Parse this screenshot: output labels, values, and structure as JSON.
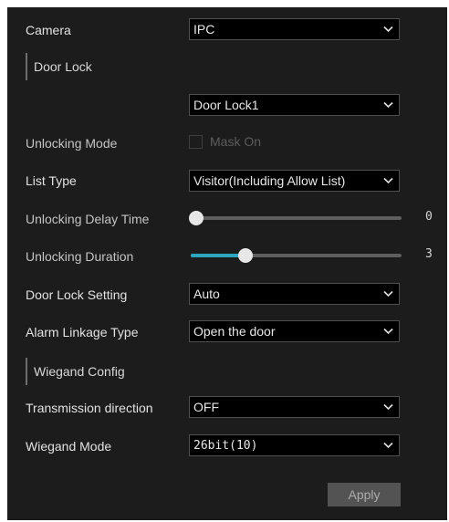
{
  "form": {
    "camera_label": "Camera",
    "camera_value": "IPC",
    "door_lock_section": "Door Lock",
    "door_lock_value": "Door Lock1",
    "unlocking_mode_label": "Unlocking Mode",
    "mask_on_label": "Mask On",
    "mask_on_checked": false,
    "list_type_label": "List Type",
    "list_type_value": "Visitor(Including Allow List)",
    "unlocking_delay_label": "Unlocking Delay Time",
    "unlocking_delay_value": "0",
    "unlocking_delay_fraction": 0.0,
    "unlocking_duration_label": "Unlocking Duration",
    "unlocking_duration_value": "3",
    "unlocking_duration_fraction": 0.25,
    "door_lock_setting_label": "Door Lock Setting",
    "door_lock_setting_value": "Auto",
    "alarm_linkage_label": "Alarm Linkage Type",
    "alarm_linkage_value": "Open the door",
    "wiegand_section": "Wiegand Config",
    "transmission_label": "Transmission direction",
    "transmission_value": "OFF",
    "wiegand_mode_label": "Wiegand Mode",
    "wiegand_mode_value": "26bit(10)",
    "apply_label": "Apply"
  },
  "colors": {
    "panel_bg": "#1c1c1c",
    "slider_accent": "#2ea6bf",
    "input_bg": "#000000"
  },
  "icons": {
    "dropdown": "chevron-down-icon"
  }
}
